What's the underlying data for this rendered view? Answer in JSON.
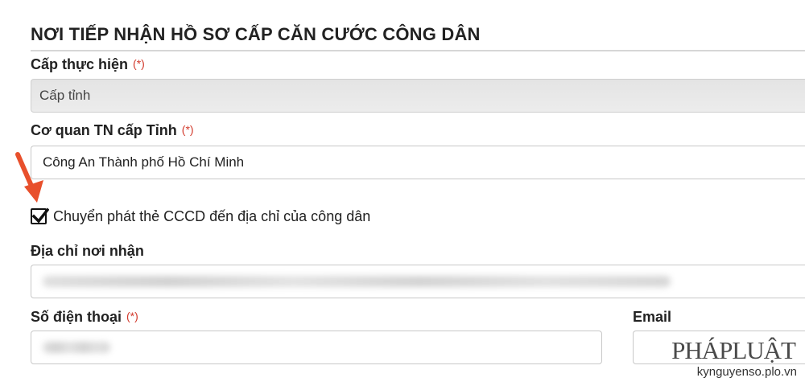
{
  "section": {
    "title": "NƠI TIẾP NHẬN HỒ SƠ CẤP CĂN CƯỚC CÔNG DÂN"
  },
  "required_mark": "(*)",
  "cap_thuc_hien": {
    "label": "Cấp thực hiện",
    "value": "Cấp tỉnh"
  },
  "co_quan": {
    "label": "Cơ quan TN cấp Tỉnh",
    "value": "Công An Thành phố Hồ Chí Minh"
  },
  "delivery": {
    "label": "Chuyển phát thẻ CCCD đến địa chỉ của công dân",
    "checked": true
  },
  "dia_chi": {
    "label": "Địa chỉ nơi nhận",
    "value_state": "blurred"
  },
  "phone": {
    "label": "Số điện thoại",
    "value_state": "blurred"
  },
  "email": {
    "label": "Email",
    "value": ""
  },
  "annotation": {
    "icon": "red-arrow-icon",
    "color": "#e8502c"
  },
  "brand": {
    "logo": "PHÁPLUẬT",
    "site": "kynguyenso.plo.vn"
  }
}
